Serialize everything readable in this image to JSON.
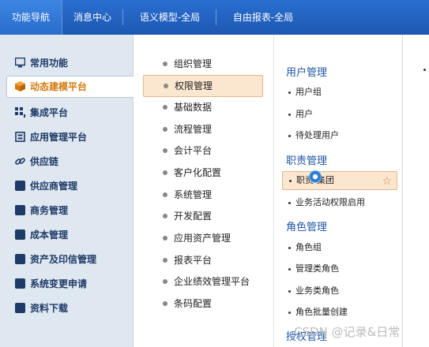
{
  "tabs": [
    {
      "label": "功能导航",
      "active": true
    },
    {
      "label": "消息中心",
      "active": false
    },
    {
      "label": "语义模型-全局",
      "active": false
    },
    {
      "label": "自由报表-全局",
      "active": false
    }
  ],
  "sidebar": {
    "items": [
      {
        "label": "常用功能",
        "icon": "monitor-icon"
      },
      {
        "label": "动态建模平台",
        "icon": "cube-icon",
        "active": true
      },
      {
        "label": "集成平台",
        "icon": "grid-icon"
      },
      {
        "label": "应用管理平台",
        "icon": "app-icon"
      },
      {
        "label": "供应链",
        "icon": "link-icon"
      },
      {
        "label": "供应商管理",
        "icon": "folder-icon"
      },
      {
        "label": "商务管理",
        "icon": "folder-icon"
      },
      {
        "label": "成本管理",
        "icon": "folder-icon"
      },
      {
        "label": "资产及印信管理",
        "icon": "folder-icon"
      },
      {
        "label": "系统变更申请",
        "icon": "folder-icon"
      },
      {
        "label": "资料下载",
        "icon": "folder-icon"
      }
    ]
  },
  "middle": {
    "items": [
      {
        "label": "组织管理"
      },
      {
        "label": "权限管理",
        "active": true
      },
      {
        "label": "基础数据"
      },
      {
        "label": "流程管理"
      },
      {
        "label": "会计平台"
      },
      {
        "label": "客户化配置"
      },
      {
        "label": "系统管理"
      },
      {
        "label": "开发配置"
      },
      {
        "label": "应用资产管理"
      },
      {
        "label": "报表平台"
      },
      {
        "label": "企业绩效管理平台"
      },
      {
        "label": "条码配置"
      }
    ]
  },
  "right": {
    "groups": [
      {
        "title": "用户管理",
        "items": [
          "用户组",
          "用户",
          "待处理用户"
        ]
      },
      {
        "title": "职责管理",
        "items": [
          "职责-集团",
          "业务活动权限启用"
        ]
      },
      {
        "title": "角色管理",
        "items": [
          "角色组",
          "管理类角色",
          "业务类角色",
          "角色批量创建"
        ]
      },
      {
        "title": "授权管理",
        "items": []
      }
    ]
  },
  "watermark": "CSDN @记录&日常",
  "colors": {
    "accent": "#1d57b3",
    "active_orange": "#d47a10",
    "highlight": "#fbe6d0"
  }
}
